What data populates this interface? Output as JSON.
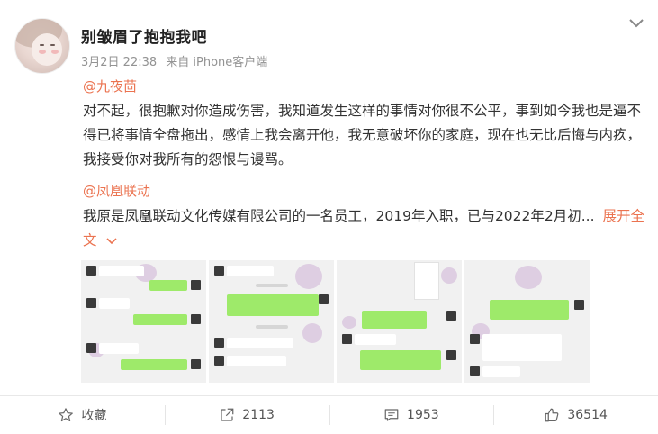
{
  "post": {
    "author": "别皱眉了抱抱我吧",
    "date": "3月2日 22:38",
    "source": "来自 iPhone客户端",
    "mention_1": "@九夜茴",
    "paragraph_1": "对不起，很抱歉对你造成伤害，我知道发生这样的事情对你很不公平，事到如今我也是逼不得已将事情全盘拖出，感情上我会离开他，我无意破坏你的家庭，现在也无比后悔与内疚，我接受你对我所有的怨恨与谩骂。",
    "mention_2": "@凤凰联动",
    "paragraph_2": "我原是凤凰联动文化传媒有限公司的一名员工，2019年入职，已与2022年2月初...",
    "expand_label": "展开全文"
  },
  "images": [
    {
      "alt": "chat-screenshot-1"
    },
    {
      "alt": "chat-screenshot-2"
    },
    {
      "alt": "chat-screenshot-3"
    },
    {
      "alt": "chat-screenshot-4"
    }
  ],
  "actions": {
    "favorite_label": "收藏",
    "repost_count": "2113",
    "comment_count": "1953",
    "like_count": "36514"
  },
  "icons": {
    "favorite": "star-icon",
    "repost": "share-icon",
    "comment": "comment-icon",
    "like": "thumbs-up-icon",
    "menu": "chevron-down-icon"
  },
  "colors": {
    "accent": "#eb7350",
    "chat_green": "#9eea6a"
  }
}
